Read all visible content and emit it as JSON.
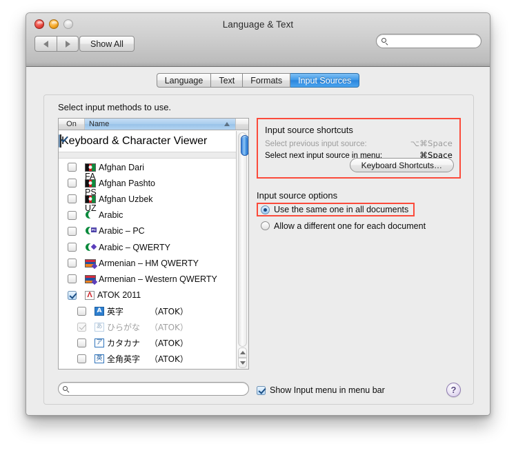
{
  "window": {
    "title": "Language & Text",
    "traffic_lights": [
      "close",
      "minimize",
      "zoom"
    ],
    "show_all_label": "Show All",
    "toolbar_search_placeholder": ""
  },
  "tabs": [
    {
      "label": "Language",
      "active": false
    },
    {
      "label": "Text",
      "active": false
    },
    {
      "label": "Formats",
      "active": false
    },
    {
      "label": "Input Sources",
      "active": true
    }
  ],
  "main": {
    "prompt": "Select input methods to use.",
    "list": {
      "headers": {
        "on": "On",
        "name": "Name",
        "sort": "ascending"
      },
      "pinned_row": {
        "checked": true,
        "name": "Keyboard & Character Viewer",
        "icon": "keyboard-viewer-icon"
      },
      "rows": [
        {
          "checked": false,
          "name": "Afghan Dari",
          "icon": "flag-afghanistan",
          "tag": "FA",
          "sub": false,
          "disabled": false
        },
        {
          "checked": false,
          "name": "Afghan Pashto",
          "icon": "flag-afghanistan",
          "tag": "PS",
          "sub": false,
          "disabled": false
        },
        {
          "checked": false,
          "name": "Afghan Uzbek",
          "icon": "flag-afghanistan",
          "tag": "UZ",
          "sub": false,
          "disabled": false
        },
        {
          "checked": false,
          "name": "Arabic",
          "icon": "crescent",
          "tag": "",
          "sub": false,
          "disabled": false
        },
        {
          "checked": false,
          "name": "Arabic – PC",
          "icon": "crescent-pc",
          "tag": "PC",
          "sub": false,
          "disabled": false
        },
        {
          "checked": false,
          "name": "Arabic – QWERTY",
          "icon": "crescent-diamond",
          "tag": "",
          "sub": false,
          "disabled": false
        },
        {
          "checked": false,
          "name": "Armenian – HM QWERTY",
          "icon": "flag-armenia",
          "tag": "",
          "sub": false,
          "disabled": false
        },
        {
          "checked": false,
          "name": "Armenian – Western QWERTY",
          "icon": "flag-armenia",
          "tag": "",
          "sub": false,
          "disabled": false
        },
        {
          "checked": true,
          "name": "ATOK 2011",
          "icon": "atok-logo",
          "tag": "",
          "sub": false,
          "disabled": false
        }
      ],
      "sub_rows": [
        {
          "checked": false,
          "glyph": "A",
          "glyph_style": "fill",
          "name": "英字",
          "suffix": "（ATOK）",
          "disabled": false
        },
        {
          "checked": true,
          "glyph": "あ",
          "glyph_style": "dim",
          "name": "ひらがな",
          "suffix": "（ATOK）",
          "disabled": true
        },
        {
          "checked": false,
          "glyph": "ア",
          "glyph_style": "",
          "name": "カタカナ",
          "suffix": "（ATOK）",
          "disabled": false
        },
        {
          "checked": false,
          "glyph": "英",
          "glyph_style": "",
          "name": "全角英字",
          "suffix": "（ATOK）",
          "disabled": false
        }
      ]
    },
    "shortcuts": {
      "title": "Input source shortcuts",
      "rows": [
        {
          "key": "Select previous input source:",
          "value": "⌥⌘Space",
          "dim": true
        },
        {
          "key": "Select next input source in menu:",
          "value": "⌘Space",
          "dim": false
        }
      ],
      "button": "Keyboard Shortcuts…"
    },
    "options": {
      "title": "Input source options",
      "choices": [
        {
          "label": "Use the same one in all documents",
          "selected": true
        },
        {
          "label": "Allow a different one for each document",
          "selected": false
        }
      ]
    },
    "bottom": {
      "search_placeholder": "",
      "show_menu_label": "Show Input menu in menu bar",
      "show_menu_checked": true,
      "help_label": "?"
    }
  },
  "annotations": {
    "color": "#fb4a3a",
    "boxes": [
      "input-source-shortcuts",
      "use-the-same-one-in-all-documents"
    ]
  }
}
